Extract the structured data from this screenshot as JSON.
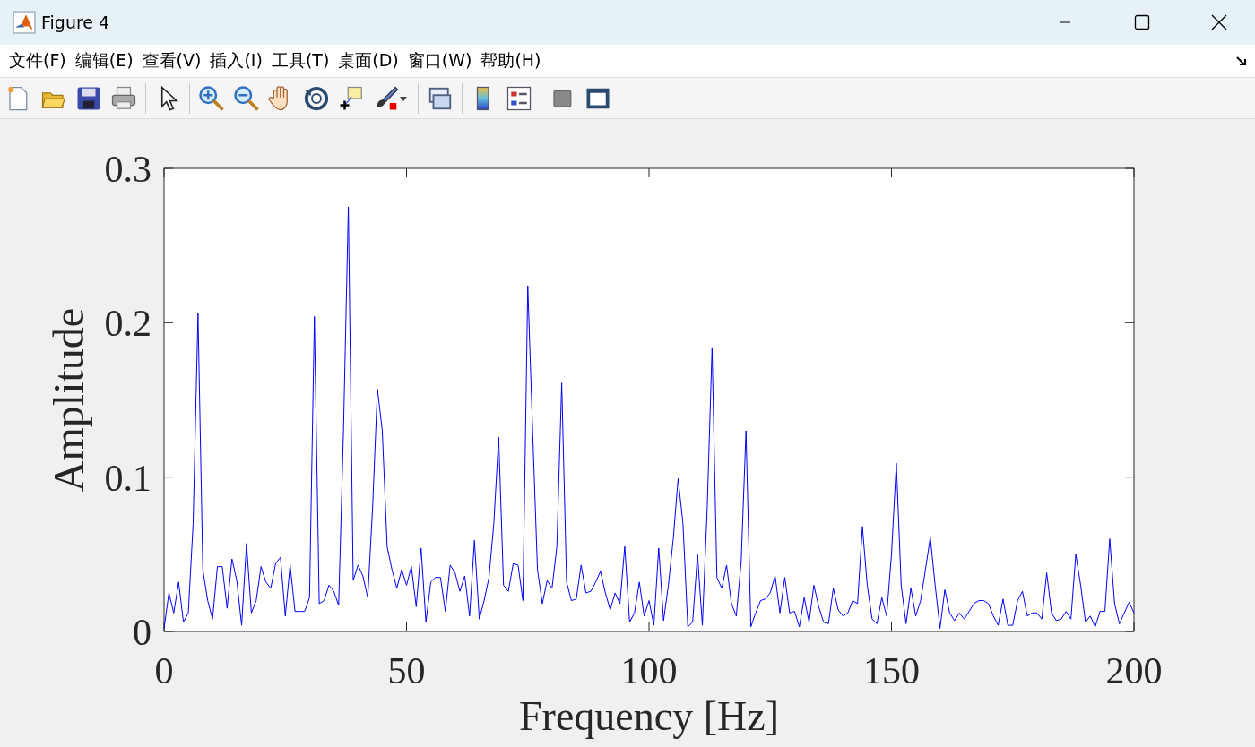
{
  "window": {
    "title": "Figure 4"
  },
  "menu": [
    "文件(F)",
    "编辑(E)",
    "查看(V)",
    "插入(I)",
    "工具(T)",
    "桌面(D)",
    "窗口(W)",
    "帮助(H)"
  ],
  "toolbar": [
    {
      "kind": "new"
    },
    {
      "kind": "open"
    },
    {
      "kind": "save"
    },
    {
      "kind": "print"
    },
    {
      "kind": "sep"
    },
    {
      "kind": "pointer"
    },
    {
      "kind": "sep"
    },
    {
      "kind": "zoomin"
    },
    {
      "kind": "zoomout"
    },
    {
      "kind": "pan"
    },
    {
      "kind": "rotate"
    },
    {
      "kind": "datacursor"
    },
    {
      "kind": "brush"
    },
    {
      "kind": "caret"
    },
    {
      "kind": "sep"
    },
    {
      "kind": "link"
    },
    {
      "kind": "sep"
    },
    {
      "kind": "colorbar"
    },
    {
      "kind": "legend"
    },
    {
      "kind": "sep"
    },
    {
      "kind": "square"
    },
    {
      "kind": "window"
    }
  ],
  "figure": {
    "chart_data": {
      "type": "line",
      "xlabel": "Frequency [Hz]",
      "ylabel": "Amplitude",
      "xlim": [
        0,
        200
      ],
      "ylim": [
        0,
        0.3
      ],
      "xticks": [
        {
          "value": 0,
          "label": "0"
        },
        {
          "value": 50,
          "label": "50"
        },
        {
          "value": 100,
          "label": "100"
        },
        {
          "value": 150,
          "label": "150"
        },
        {
          "value": 200,
          "label": "200"
        }
      ],
      "yticks": [
        {
          "value": 0,
          "label": "0"
        },
        {
          "value": 0.1,
          "label": "0.1"
        },
        {
          "value": 0.2,
          "label": "0.2"
        },
        {
          "value": 0.3,
          "label": "0.3"
        }
      ],
      "x": [
        0,
        1,
        2,
        3,
        4,
        5,
        6,
        7,
        8,
        9,
        10,
        11,
        12,
        13,
        14,
        15,
        16,
        17,
        18,
        19,
        20,
        21,
        22,
        23,
        24,
        25,
        26,
        27,
        28,
        29,
        30,
        31,
        32,
        33,
        34,
        35,
        36,
        37,
        38,
        39,
        40,
        41,
        42,
        43,
        44,
        45,
        46,
        47,
        48,
        49,
        50,
        51,
        52,
        53,
        54,
        55,
        56,
        57,
        58,
        59,
        60,
        61,
        62,
        63,
        64,
        65,
        66,
        67,
        68,
        69,
        70,
        71,
        72,
        73,
        74,
        75,
        76,
        77,
        78,
        79,
        80,
        81,
        82,
        83,
        84,
        85,
        86,
        87,
        88,
        89,
        90,
        91,
        92,
        93,
        94,
        95,
        96,
        97,
        98,
        99,
        100,
        101,
        102,
        103,
        104,
        105,
        106,
        107,
        108,
        109,
        110,
        111,
        112,
        113,
        114,
        115,
        116,
        117,
        118,
        119,
        120,
        121,
        122,
        123,
        124,
        125,
        126,
        127,
        128,
        129,
        130,
        131,
        132,
        133,
        134,
        135,
        136,
        137,
        138,
        139,
        140,
        141,
        142,
        143,
        144,
        145,
        146,
        147,
        148,
        149,
        150,
        151,
        152,
        153,
        154,
        155,
        156,
        157,
        158,
        159,
        160,
        161,
        162,
        163,
        164,
        165,
        166,
        167,
        168,
        169,
        170,
        171,
        172,
        173,
        174,
        175,
        176,
        177,
        178,
        179,
        180,
        181,
        182,
        183,
        184,
        185,
        186,
        187,
        188,
        189,
        190,
        191,
        192,
        193,
        194,
        195,
        196,
        197,
        198,
        199,
        200
      ],
      "series": [
        {
          "color": "#0000ff",
          "values": [
            0.002,
            0.025,
            0.012,
            0.032,
            0.006,
            0.012,
            0.07,
            0.206,
            0.04,
            0.02,
            0.008,
            0.042,
            0.042,
            0.015,
            0.047,
            0.033,
            0.004,
            0.057,
            0.012,
            0.02,
            0.042,
            0.032,
            0.028,
            0.044,
            0.048,
            0.01,
            0.043,
            0.013,
            0.013,
            0.013,
            0.022,
            0.204,
            0.018,
            0.02,
            0.03,
            0.026,
            0.017,
            0.13,
            0.275,
            0.033,
            0.043,
            0.036,
            0.022,
            0.08,
            0.157,
            0.13,
            0.055,
            0.04,
            0.028,
            0.04,
            0.03,
            0.042,
            0.016,
            0.054,
            0.006,
            0.032,
            0.035,
            0.035,
            0.013,
            0.043,
            0.038,
            0.026,
            0.036,
            0.01,
            0.059,
            0.008,
            0.02,
            0.035,
            0.07,
            0.126,
            0.03,
            0.026,
            0.044,
            0.043,
            0.02,
            0.224,
            0.13,
            0.04,
            0.018,
            0.033,
            0.028,
            0.055,
            0.161,
            0.032,
            0.02,
            0.021,
            0.043,
            0.025,
            0.026,
            0.032,
            0.039,
            0.025,
            0.014,
            0.025,
            0.018,
            0.055,
            0.006,
            0.012,
            0.032,
            0.01,
            0.02,
            0.004,
            0.054,
            0.007,
            0.03,
            0.06,
            0.099,
            0.07,
            0.003,
            0.006,
            0.05,
            0.004,
            0.08,
            0.184,
            0.035,
            0.028,
            0.043,
            0.018,
            0.01,
            0.045,
            0.13,
            0.003,
            0.012,
            0.02,
            0.021,
            0.025,
            0.036,
            0.012,
            0.035,
            0.012,
            0.013,
            0.003,
            0.022,
            0.006,
            0.03,
            0.016,
            0.006,
            0.005,
            0.028,
            0.014,
            0.01,
            0.012,
            0.02,
            0.018,
            0.068,
            0.03,
            0.008,
            0.005,
            0.022,
            0.01,
            0.05,
            0.109,
            0.03,
            0.005,
            0.028,
            0.01,
            0.02,
            0.04,
            0.061,
            0.03,
            0.002,
            0.027,
            0.012,
            0.007,
            0.012,
            0.008,
            0.013,
            0.018,
            0.02,
            0.02,
            0.018,
            0.01,
            0.004,
            0.021,
            0.004,
            0.004,
            0.02,
            0.026,
            0.01,
            0.012,
            0.012,
            0.008,
            0.038,
            0.012,
            0.007,
            0.008,
            0.013,
            0.008,
            0.05,
            0.03,
            0.006,
            0.01,
            0.003,
            0.013,
            0.013,
            0.06,
            0.018,
            0.005,
            0.012,
            0.019,
            0.012
          ]
        }
      ]
    }
  }
}
